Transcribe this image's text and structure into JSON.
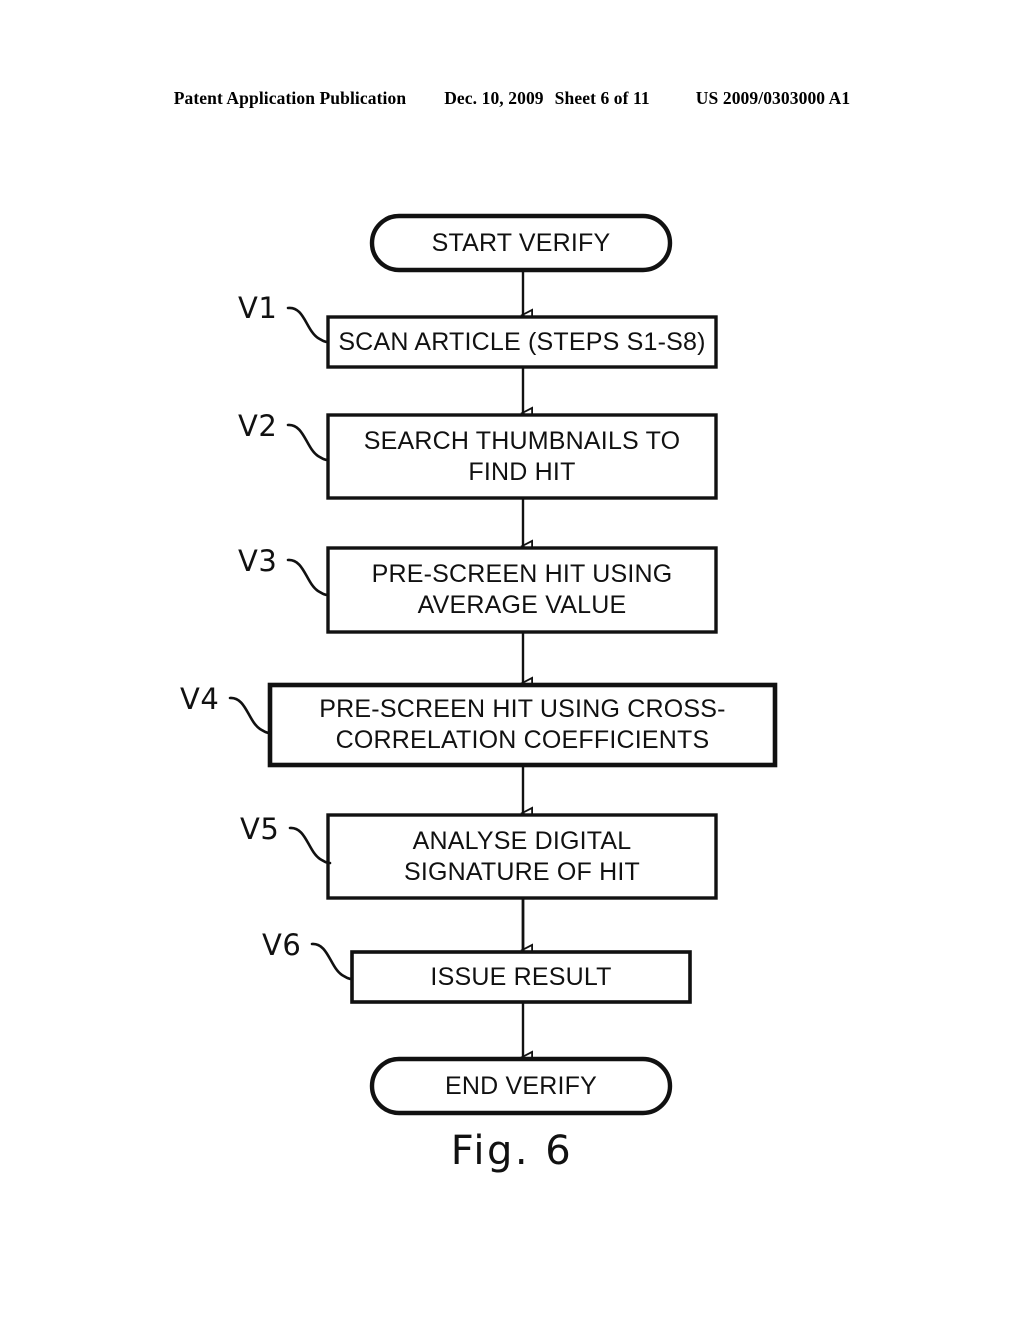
{
  "header": {
    "publication": "Patent Application Publication",
    "date": "Dec. 10, 2009",
    "sheet": "Sheet 6 of 11",
    "patent_number": "US 2009/0303000 A1"
  },
  "figure": {
    "caption": "Fig. 6",
    "title": "Verification process flowchart",
    "ink_color": "#111111",
    "background_color": "#ffffff"
  },
  "flowchart": {
    "start": {
      "label": "START VERIFY",
      "shape": "stadium"
    },
    "end": {
      "label": "END VERIFY",
      "shape": "stadium"
    },
    "steps": [
      {
        "ref": "V1",
        "label": "SCAN ARTICLE (STEPS S1-S8)",
        "shape": "rect"
      },
      {
        "ref": "V2",
        "label": "SEARCH THUMBNAILS TO\nFIND HIT",
        "shape": "rect"
      },
      {
        "ref": "V3",
        "label": "PRE-SCREEN HIT USING\nAVERAGE VALUE",
        "shape": "rect"
      },
      {
        "ref": "V4",
        "label": "PRE-SCREEN HIT USING CROSS-\nCORRELATION COEFFICIENTS",
        "shape": "rect"
      },
      {
        "ref": "V5",
        "label": "ANALYSE DIGITAL\nSIGNATURE OF HIT",
        "shape": "rect"
      },
      {
        "ref": "V6",
        "label": "ISSUE RESULT",
        "shape": "rect"
      }
    ]
  }
}
